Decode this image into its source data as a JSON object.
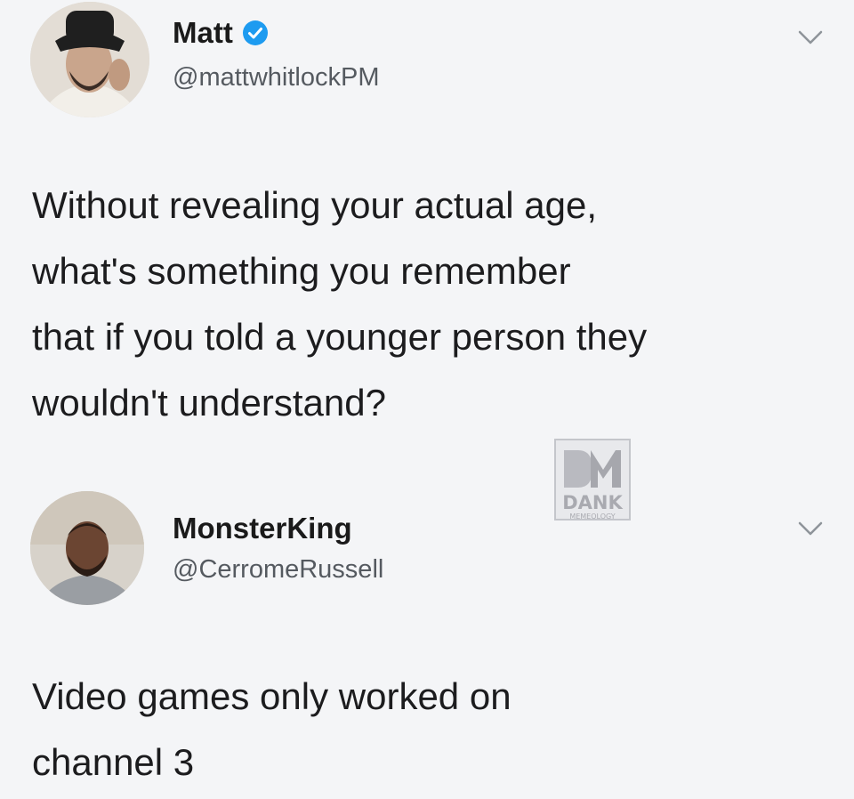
{
  "tweet": {
    "author_name": "Matt",
    "author_handle": "@mattwhitlockPM",
    "verified": true,
    "text": "Without revealing your actual age,\nwhat's something you remember\nthat if you told a younger person they\nwouldn't understand?",
    "avatar_icon": "person-with-bucket-hat-avatar",
    "menu_icon": "chevron-down-icon"
  },
  "reply": {
    "author_name": "MonsterKing",
    "author_handle": "@CerromeRussell",
    "text": "Video games only worked on\nchannel 3",
    "avatar_icon": "person-avatar",
    "menu_icon": "chevron-down-icon"
  },
  "watermark": {
    "mark": "DM",
    "word": "DANK",
    "subword": "MEMEOLOGY"
  },
  "colors": {
    "background": "#f4f5f7",
    "text": "#1c1c1e",
    "handle": "#555a60",
    "verified_badge": "#1d9bf0"
  }
}
